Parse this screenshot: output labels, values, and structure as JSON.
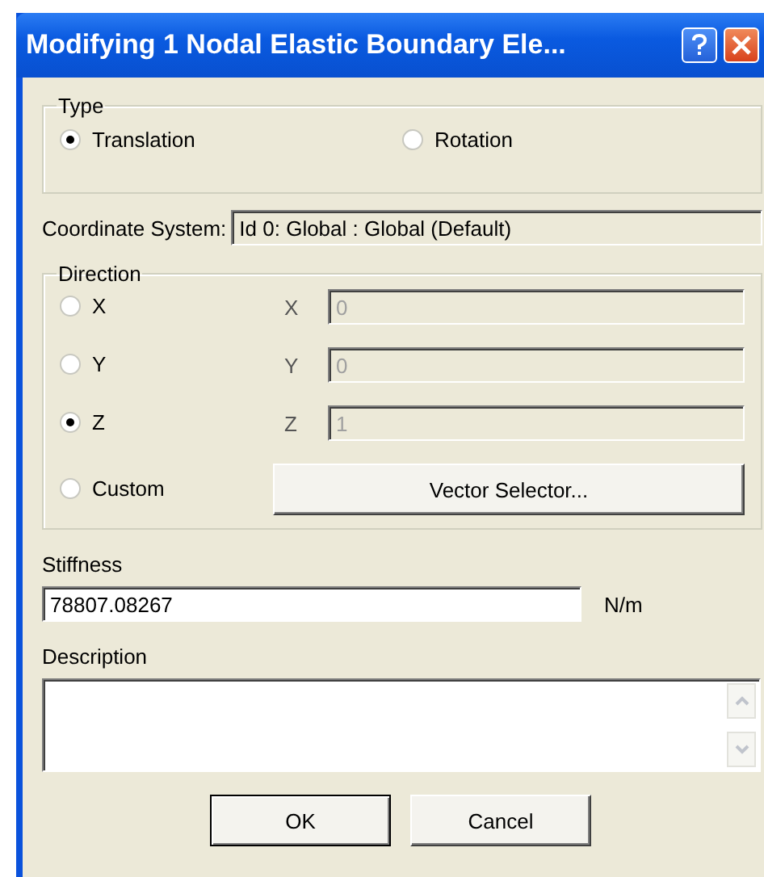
{
  "window": {
    "title": "Modifying 1 Nodal Elastic Boundary Ele..."
  },
  "type": {
    "legend": "Type",
    "options": [
      {
        "label": "Translation",
        "selected": true
      },
      {
        "label": "Rotation",
        "selected": false
      }
    ]
  },
  "coordinate_system": {
    "label": "Coordinate System:",
    "value": "Id 0: Global : Global (Default)"
  },
  "direction": {
    "legend": "Direction",
    "options": [
      {
        "label": "X",
        "selected": false
      },
      {
        "label": "Y",
        "selected": false
      },
      {
        "label": "Z",
        "selected": true
      },
      {
        "label": "Custom",
        "selected": false
      }
    ],
    "components": [
      {
        "label": "X",
        "value": "0",
        "disabled": true
      },
      {
        "label": "Y",
        "value": "0",
        "disabled": true
      },
      {
        "label": "Z",
        "value": "1",
        "disabled": true
      }
    ],
    "vector_button": "Vector Selector..."
  },
  "stiffness": {
    "label": "Stiffness",
    "value": "78807.08267",
    "unit": "N/m"
  },
  "description": {
    "label": "Description"
  },
  "buttons": [
    {
      "label": "OK",
      "default": true
    },
    {
      "label": "Cancel",
      "default": false
    }
  ]
}
